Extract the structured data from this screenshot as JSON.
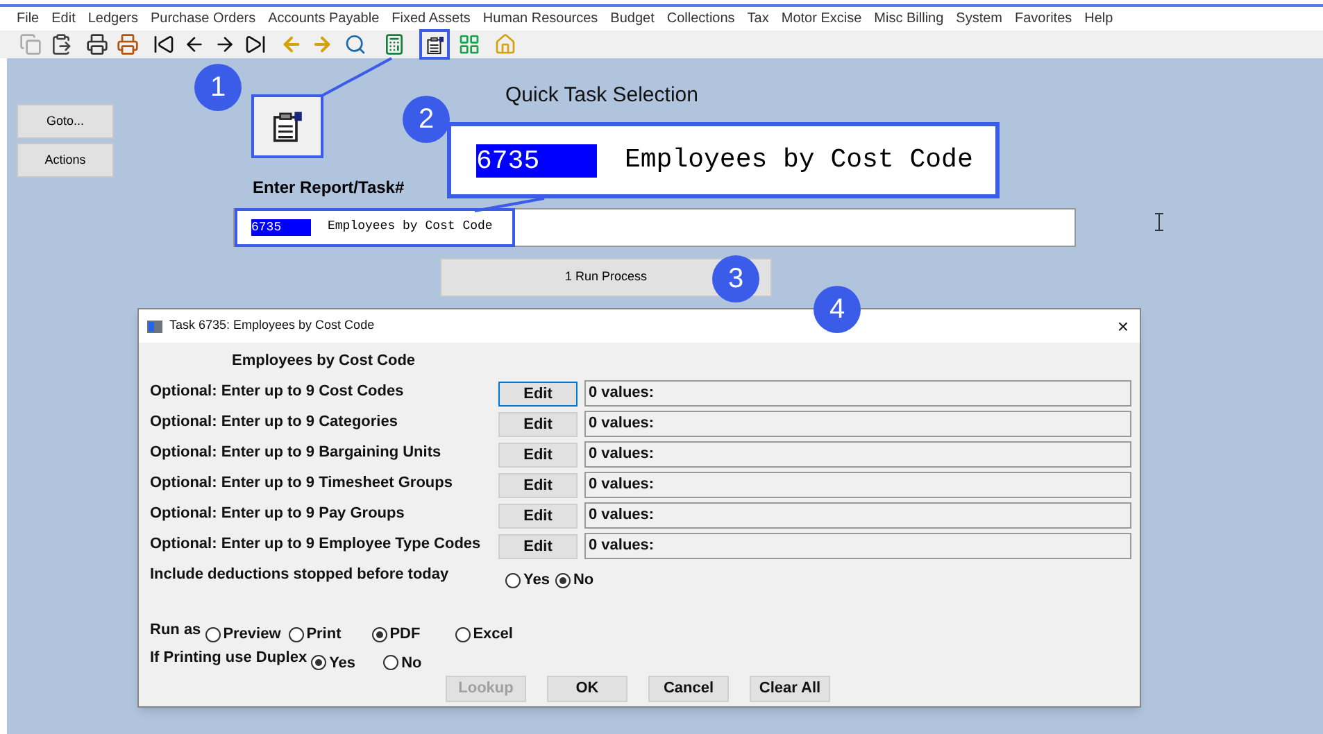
{
  "menu_bar": [
    "File",
    "Edit",
    "Ledgers",
    "Purchase Orders",
    "Accounts Payable",
    "Fixed Assets",
    "Human Resources",
    "Budget",
    "Collections",
    "Tax",
    "Motor Excise",
    "Misc Billing",
    "System",
    "Favorites",
    "Help"
  ],
  "side_buttons": [
    "Goto...",
    "Actions"
  ],
  "quick_task": {
    "title": "Quick Task Selection",
    "field_label": "Enter Report/Task#",
    "task_number": "6735",
    "task_name": "Employees by Cost Code",
    "run_button": "1 Run Process"
  },
  "callouts": [
    {
      "number": "1",
      "kind": "icon"
    },
    {
      "number": "2",
      "kind": "text",
      "task_number": "6735",
      "task_name": "Employees by Cost Code"
    },
    {
      "number": "3",
      "kind": "plain"
    },
    {
      "number": "4",
      "kind": "plain"
    }
  ],
  "dialog": {
    "title": "Task 6735: Employees by Cost Code",
    "close": "×",
    "heading": "Employees by Cost Code",
    "filters": [
      {
        "label": "Optional: Enter up to 9 Cost Codes",
        "button": "Edit",
        "value": "0 values:",
        "focused": true
      },
      {
        "label": "Optional: Enter up to 9 Categories",
        "button": "Edit",
        "value": "0 values:",
        "focused": false
      },
      {
        "label": "Optional: Enter up to 9 Bargaining Units",
        "button": "Edit",
        "value": "0 values:",
        "focused": false
      },
      {
        "label": "Optional: Enter up to 9 Timesheet Groups",
        "button": "Edit",
        "value": "0 values:",
        "focused": false
      },
      {
        "label": "Optional: Enter up to 9 Pay Groups",
        "button": "Edit",
        "value": "0 values:",
        "focused": false
      },
      {
        "label": "Optional: Enter up to 9 Employee Type Codes",
        "button": "Edit",
        "value": "0 values:",
        "focused": false
      }
    ],
    "include_deductions": {
      "label": "Include deductions stopped before today",
      "options": [
        {
          "label": "Yes",
          "selected": false
        },
        {
          "label": "No",
          "selected": true
        }
      ]
    },
    "run_as": {
      "label": "Run as",
      "options": [
        {
          "label": "Preview",
          "selected": false
        },
        {
          "label": "Print",
          "selected": false
        },
        {
          "label": "PDF",
          "selected": true
        },
        {
          "label": "Excel",
          "selected": false
        }
      ]
    },
    "duplex": {
      "label": "If Printing use Duplex",
      "options": [
        {
          "label": "Yes",
          "selected": true
        },
        {
          "label": "No",
          "selected": false
        }
      ]
    },
    "buttons": [
      {
        "label": "Lookup",
        "disabled": true
      },
      {
        "label": "OK",
        "disabled": false
      },
      {
        "label": "Cancel",
        "disabled": false
      },
      {
        "label": "Clear All",
        "disabled": false
      }
    ]
  }
}
